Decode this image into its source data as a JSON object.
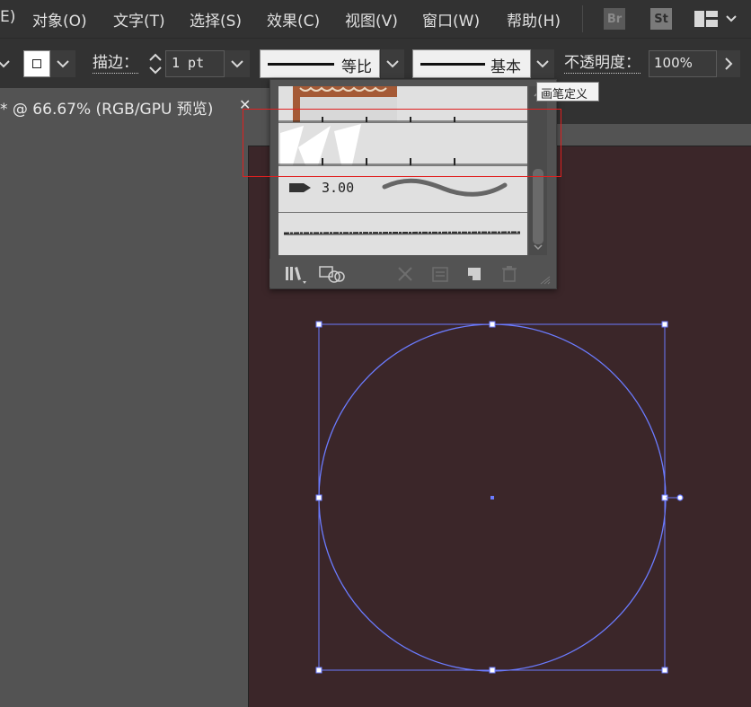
{
  "menu": {
    "items": [
      "E)",
      "对象(O)",
      "文字(T)",
      "选择(S)",
      "效果(C)",
      "视图(V)",
      "窗口(W)",
      "帮助(H)"
    ],
    "bridge_badge": "Br",
    "stock_badge": "St"
  },
  "control": {
    "stroke_label": "描边：",
    "stroke_weight": "1 pt",
    "profile_label": "等比",
    "brush_label": "基本",
    "opacity_label": "不透明度：",
    "opacity_value": "100%"
  },
  "document": {
    "tab_title": "* @ 66.67% (RGB/GPU 预览)",
    "close_glyph": "✕"
  },
  "brush_panel": {
    "selected_brush_size": "3.00",
    "tooltip": "画笔定义"
  },
  "colors": {
    "artboard": "#3b2629",
    "selection": "#6b7bff",
    "highlight": "#e02020"
  }
}
